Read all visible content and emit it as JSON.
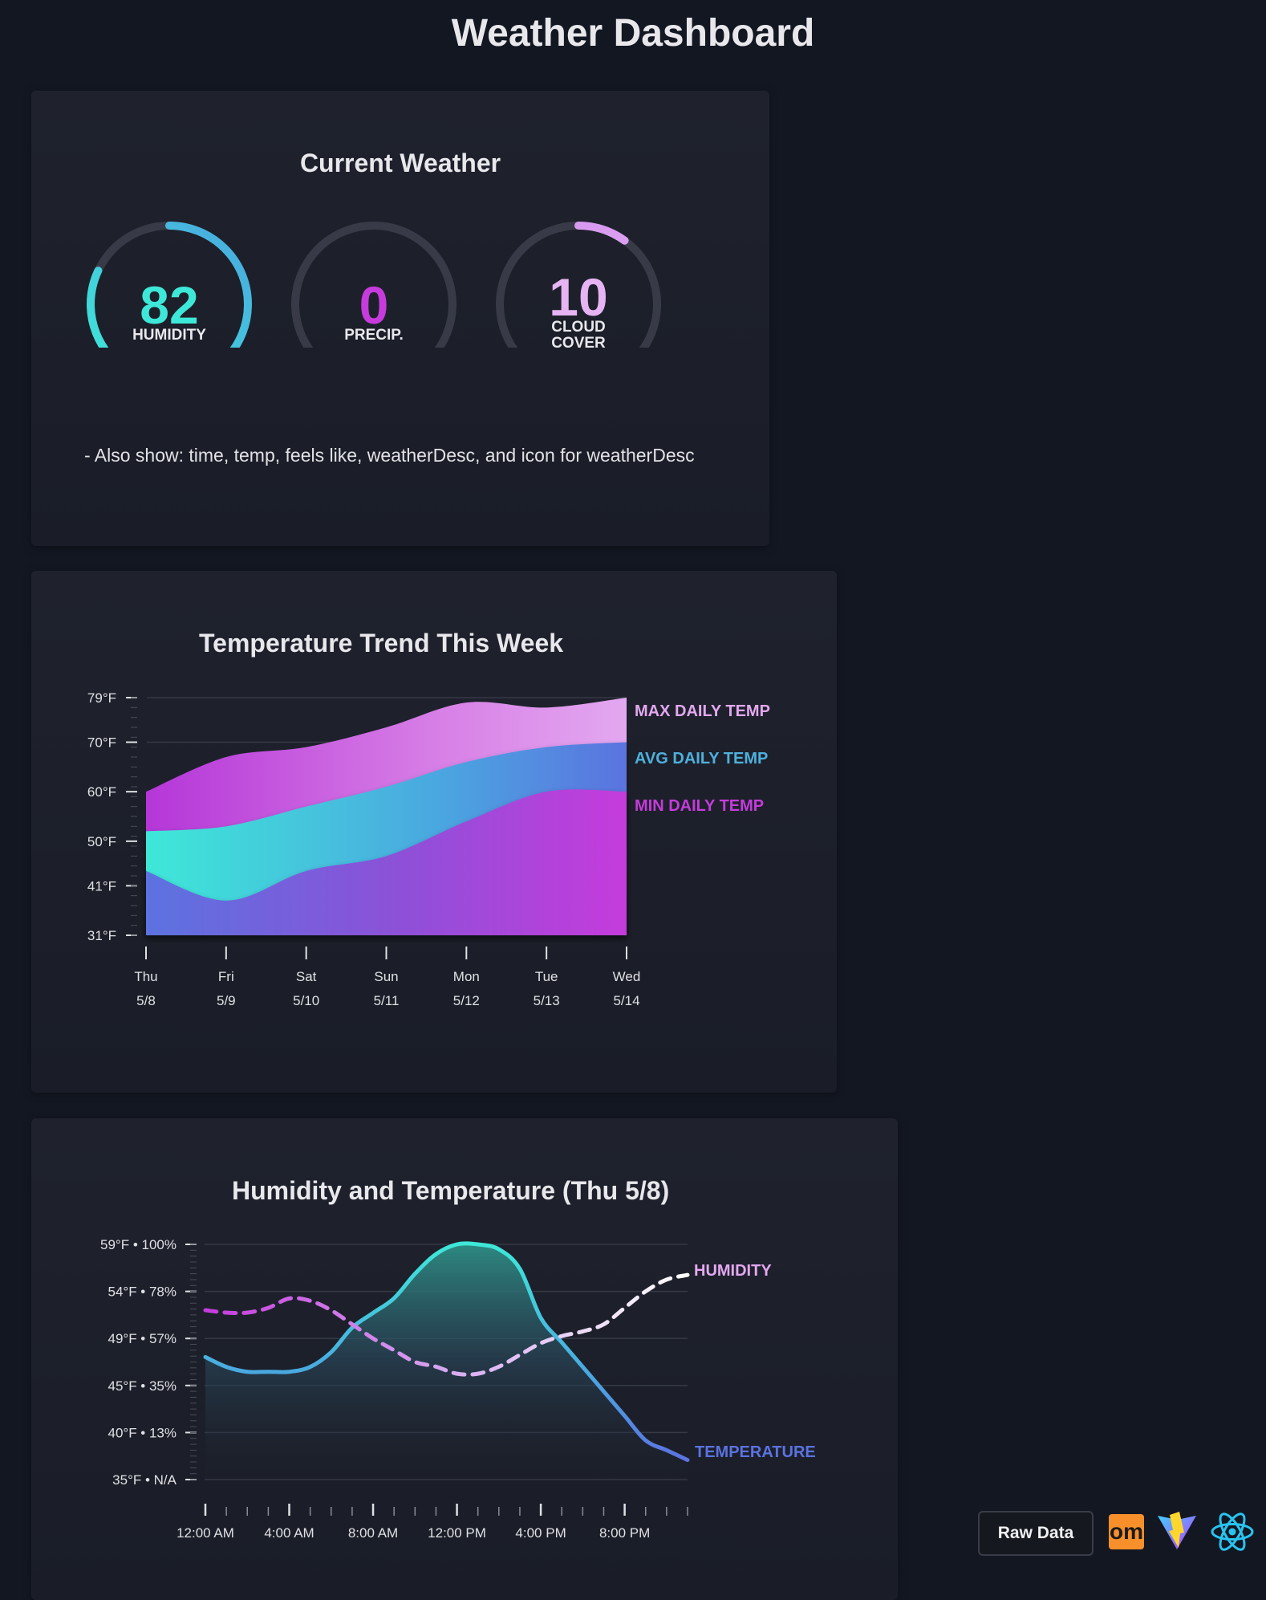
{
  "page": {
    "title": "Weather Dashboard"
  },
  "current": {
    "title": "Current Weather",
    "gauges": [
      {
        "value": "82",
        "label": "HUMIDITY",
        "fraction": 0.82
      },
      {
        "value": "0",
        "label": "PRECIP.",
        "fraction": 0.0
      },
      {
        "value": "10",
        "label_line1": "CLOUD",
        "label_line2": "COVER",
        "fraction": 0.1
      }
    ],
    "note": "- Also show: time, temp, feels like, weatherDesc, and icon for weatherDesc"
  },
  "chart_data": [
    {
      "type": "area",
      "title": "Temperature Trend This Week",
      "categories": [
        "Thu",
        "Fri",
        "Sat",
        "Sun",
        "Mon",
        "Tue",
        "Wed"
      ],
      "category_dates": [
        "5/8",
        "5/9",
        "5/10",
        "5/11",
        "5/12",
        "5/13",
        "5/14"
      ],
      "y_ticks": [
        "79°F",
        "70°F",
        "60°F",
        "50°F",
        "41°F",
        "31°F"
      ],
      "y_tick_values": [
        79,
        70,
        60,
        50,
        41,
        31
      ],
      "ylim": [
        31,
        79
      ],
      "series": [
        {
          "name": "MAX DAILY TEMP",
          "values": [
            60,
            67,
            69,
            73,
            78,
            77,
            79
          ]
        },
        {
          "name": "AVG DAILY TEMP",
          "values": [
            52,
            53,
            57,
            61,
            66,
            69,
            70
          ]
        },
        {
          "name": "MIN DAILY TEMP",
          "values": [
            44,
            38,
            44,
            47,
            54,
            60,
            60
          ]
        }
      ],
      "legend_position": "right"
    },
    {
      "type": "line",
      "title": "Humidity and Temperature (Thu 5/8)",
      "x_tick_labels": [
        "12:00 AM",
        "4:00 AM",
        "8:00 AM",
        "12:00 PM",
        "4:00 PM",
        "8:00 PM"
      ],
      "x_hours": [
        0,
        1,
        2,
        3,
        4,
        5,
        6,
        7,
        8,
        9,
        10,
        11,
        12,
        13,
        14,
        15,
        16,
        17,
        18,
        19,
        20,
        21,
        22,
        23
      ],
      "y_ticks": [
        "59°F • 100%",
        "54°F • 78%",
        "49°F • 57%",
        "45°F • 35%",
        "40°F • 13%",
        "35°F • N/A"
      ],
      "temperature_range_F": [
        35,
        59
      ],
      "humidity_range_pct": [
        0,
        100
      ],
      "series": [
        {
          "name": "TEMPERATURE",
          "unit": "°F",
          "values": [
            47.5,
            46.5,
            46,
            46,
            46,
            46.5,
            48,
            50.5,
            52,
            53.5,
            56,
            58,
            59,
            59,
            58.5,
            56.5,
            51.5,
            49,
            46.5,
            44,
            41.5,
            39,
            38,
            37
          ]
        },
        {
          "name": "HUMIDITY",
          "unit": "%",
          "values": [
            72,
            71,
            71,
            73,
            77,
            76,
            72,
            66,
            60,
            55,
            50,
            48,
            45,
            45,
            48,
            53,
            58,
            61,
            63,
            66,
            73,
            80,
            85,
            87
          ]
        }
      ],
      "legend_position": "right"
    }
  ],
  "footer": {
    "raw_data_label": "Raw Data",
    "om_logo_text": "om",
    "icons": [
      "om-logo-icon",
      "vite-logo-icon",
      "react-logo-icon"
    ]
  },
  "colors": {
    "background": "#131722",
    "card": "#1f222d",
    "cyan": "#3ee8d8",
    "blue": "#5b73e0",
    "magenta": "#c53bdc",
    "pink": "#e3a8f0"
  }
}
